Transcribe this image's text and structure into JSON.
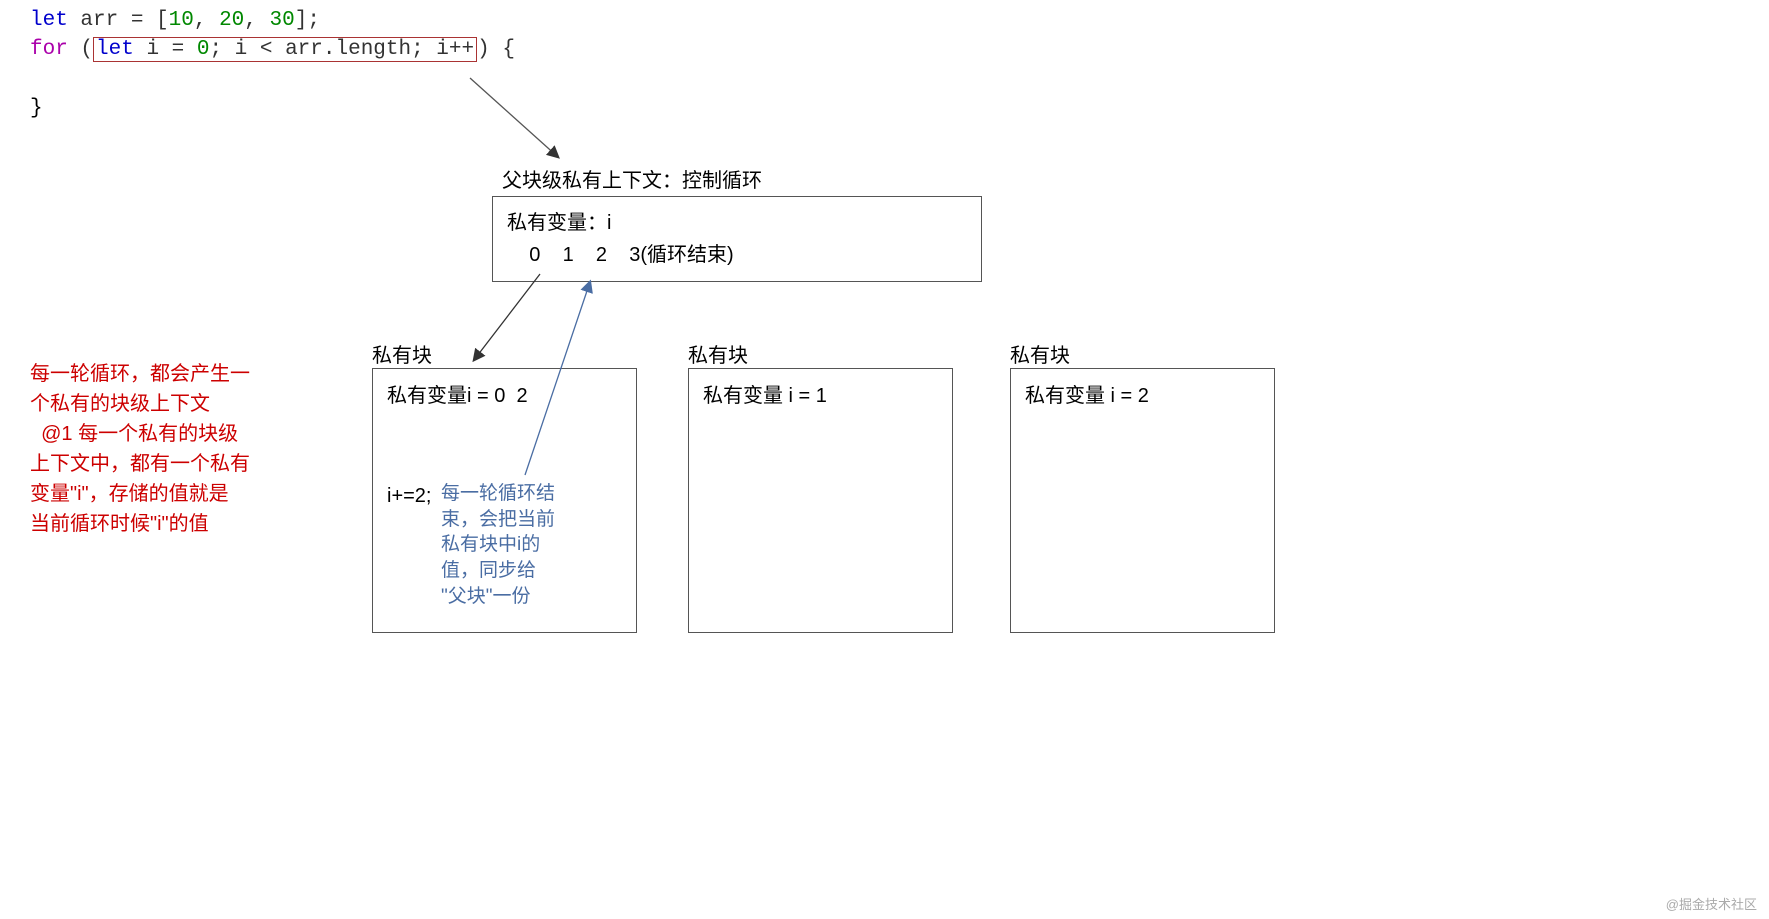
{
  "code": {
    "line1": {
      "let": "let",
      "arr": " arr = [",
      "v1": "10",
      "c1": ", ",
      "v2": "20",
      "c2": ", ",
      "v3": "30",
      "end": "];"
    },
    "line2": {
      "for": "for",
      "open": " (",
      "inner": "let i = 0; i < arr.length; i++",
      "close": ") {"
    },
    "line4": "}"
  },
  "redNote": {
    "l1": "每一轮循环，都会产生一",
    "l2": "个私有的块级上下文",
    "l3": "  @1 每一个私有的块级",
    "l4": "上下文中，都有一个私有",
    "l5": "变量\"i\"，存储的值就是",
    "l6": "当前循环时候\"i\"的值"
  },
  "parentTitle": "父块级私有上下文：控制循环",
  "parentBox": {
    "l1": "私有变量：i",
    "l2": "    0    1    2    3(循环结束)"
  },
  "blocks": {
    "title": "私有块",
    "b1": {
      "var": "私有变量i = 0",
      "extra": "  2",
      "inc": "i+=2;",
      "note1": "每一轮循环结",
      "note2": "束，会把当前",
      "note3": "私有块中i的",
      "note4": "值，同步给",
      "note5": "\"父块\"一份"
    },
    "b2": {
      "var": "私有变量 i = 1"
    },
    "b3": {
      "var": "私有变量 i  =  2"
    }
  },
  "watermark": "@掘金技术社区"
}
